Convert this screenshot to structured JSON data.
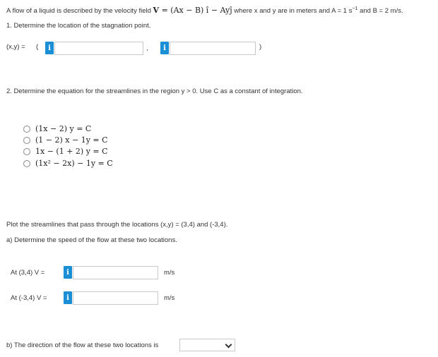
{
  "intro": {
    "text1": "A flow of a liquid is described by the velocity field",
    "eq_V": "V",
    "eq_rest": "= (Ax − B) î − Ayĵ",
    "text2": "where x and y are in meters and A = 1 s",
    "exp": "−1",
    "text3": "and B = 2 m/s."
  },
  "q1": {
    "label": "1. Determine the location of the stagnation point.",
    "prefix": "(x,y) =",
    "open_paren": "(",
    "comma": ",",
    "close_paren": ")",
    "input1_value": "",
    "input2_value": ""
  },
  "q2": {
    "label": "2. Determine the equation for the streamlines in the region y > 0. Use C as a constant of integration.",
    "options": [
      "(1x − 2) y = C",
      "(1 − 2) x − 1y = C",
      "1x − (1 + 2) y = C",
      "(1x² − 2x) − 1y = C"
    ]
  },
  "q3": {
    "intro": "Plot the streamlines that pass through the locations (x,y) = (3,4) and (-3,4).",
    "part_a": "a) Determine the speed of the flow at these two locations.",
    "row1_label": "At (3,4) V =",
    "row2_label": "At (-3,4) V =",
    "unit": "m/s",
    "row1_value": "",
    "row2_value": "",
    "part_b": "b) The direction of the flow at these two locations is",
    "select_value": ""
  },
  "icons": {
    "info": "i"
  },
  "colors": {
    "info_blue": "#1a8fd6",
    "border": "#c9c9c9"
  }
}
